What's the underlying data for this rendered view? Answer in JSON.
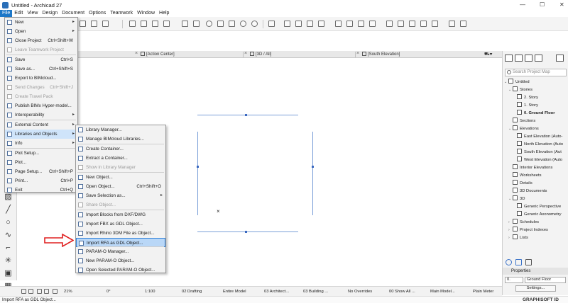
{
  "window": {
    "title": "Untitled - Archicad 27",
    "minimize": "—",
    "close": "✕"
  },
  "menubar": [
    "File",
    "Edit",
    "View",
    "Design",
    "Document",
    "Options",
    "Teamwork",
    "Window",
    "Help"
  ],
  "tabs": {
    "action_center": "[Action Center]",
    "view_3d": "[3D / All]",
    "south_elevation": "[South Elevation]"
  },
  "file_menu": [
    {
      "label": "New",
      "shortcut": "",
      "submenu": true,
      "disabled": false
    },
    {
      "label": "Open",
      "shortcut": "",
      "submenu": true,
      "disabled": false
    },
    {
      "label": "Close Project",
      "shortcut": "Ctrl+Shift+W",
      "submenu": false,
      "disabled": false
    },
    {
      "label": "Leave Teamwork Project",
      "shortcut": "",
      "submenu": false,
      "disabled": true
    },
    {
      "label": "Save",
      "shortcut": "Ctrl+S",
      "submenu": false,
      "disabled": false
    },
    {
      "label": "Save as...",
      "shortcut": "Ctrl+Shift+S",
      "submenu": false,
      "disabled": false
    },
    {
      "label": "Export to BIMcloud...",
      "shortcut": "",
      "submenu": false,
      "disabled": false
    },
    {
      "label": "Send Changes",
      "shortcut": "Ctrl+Shift+J",
      "submenu": false,
      "disabled": true
    },
    {
      "label": "Create Travel Pack",
      "shortcut": "",
      "submenu": false,
      "disabled": true
    },
    {
      "label": "Publish BIMx Hyper-model...",
      "shortcut": "",
      "submenu": false,
      "disabled": false
    },
    {
      "label": "Interoperability",
      "shortcut": "",
      "submenu": true,
      "disabled": false
    },
    {
      "label": "External Content",
      "shortcut": "",
      "submenu": true,
      "disabled": false
    },
    {
      "label": "Libraries and Objects",
      "shortcut": "",
      "submenu": true,
      "disabled": false
    },
    {
      "label": "Info",
      "shortcut": "",
      "submenu": true,
      "disabled": false
    },
    {
      "label": "Plot Setup...",
      "shortcut": "",
      "submenu": false,
      "disabled": false
    },
    {
      "label": "Plot...",
      "shortcut": "",
      "submenu": false,
      "disabled": false
    },
    {
      "label": "Page Setup...",
      "shortcut": "Ctrl+Shift+P",
      "submenu": false,
      "disabled": false
    },
    {
      "label": "Print...",
      "shortcut": "Ctrl+P",
      "submenu": false,
      "disabled": false
    },
    {
      "label": "Exit",
      "shortcut": "Ctrl+Q",
      "submenu": false,
      "disabled": false
    }
  ],
  "libraries_menu": [
    {
      "label": "Library Manager...",
      "shortcut": "",
      "submenu": false,
      "disabled": false
    },
    {
      "label": "Manage BIMcloud Libraries...",
      "shortcut": "",
      "submenu": false,
      "disabled": false
    },
    {
      "label": "Create Container...",
      "shortcut": "",
      "submenu": false,
      "disabled": false
    },
    {
      "label": "Extract a Container...",
      "shortcut": "",
      "submenu": false,
      "disabled": false
    },
    {
      "label": "Show in Library Manager",
      "shortcut": "",
      "submenu": false,
      "disabled": true
    },
    {
      "label": "New Object...",
      "shortcut": "",
      "submenu": false,
      "disabled": false
    },
    {
      "label": "Open Object...",
      "shortcut": "Ctrl+Shift+O",
      "submenu": false,
      "disabled": false
    },
    {
      "label": "Save Selection as...",
      "shortcut": "",
      "submenu": true,
      "disabled": false
    },
    {
      "label": "Share Object...",
      "shortcut": "",
      "submenu": false,
      "disabled": true
    },
    {
      "label": "Import Blocks from DXF/DWG",
      "shortcut": "",
      "submenu": false,
      "disabled": false
    },
    {
      "label": "Import FBX as GDL Object...",
      "shortcut": "",
      "submenu": false,
      "disabled": false
    },
    {
      "label": "Import Rhino 3DM File as Object...",
      "shortcut": "",
      "submenu": false,
      "disabled": false
    },
    {
      "label": "Import RFA as GDL Object...",
      "shortcut": "",
      "submenu": false,
      "disabled": false
    },
    {
      "label": "PARAM-O Manager...",
      "shortcut": "",
      "submenu": false,
      "disabled": false
    },
    {
      "label": "New PARAM-O Object...",
      "shortcut": "",
      "submenu": false,
      "disabled": false
    },
    {
      "label": "Open Selected PARAM-O Object...",
      "shortcut": "",
      "submenu": false,
      "disabled": false
    }
  ],
  "project_map": {
    "search_placeholder": "Search Project Map",
    "tree": [
      {
        "label": "Untitled",
        "level": 0,
        "bold": false
      },
      {
        "label": "Stories",
        "level": 1,
        "bold": false
      },
      {
        "label": "2. Story",
        "level": 2,
        "bold": false
      },
      {
        "label": "1. Story",
        "level": 2,
        "bold": false
      },
      {
        "label": "0. Ground Floor",
        "level": 2,
        "bold": true
      },
      {
        "label": "Sections",
        "level": 1,
        "bold": false
      },
      {
        "label": "Elevations",
        "level": 1,
        "bold": false
      },
      {
        "label": "East Elevation (Auto-",
        "level": 2,
        "bold": false
      },
      {
        "label": "North Elevation (Auto",
        "level": 2,
        "bold": false
      },
      {
        "label": "South Elevation (Aut",
        "level": 2,
        "bold": false
      },
      {
        "label": "West Elevation (Auto",
        "level": 2,
        "bold": false
      },
      {
        "label": "Interior Elevations",
        "level": 1,
        "bold": false
      },
      {
        "label": "Worksheets",
        "level": 1,
        "bold": false
      },
      {
        "label": "Details",
        "level": 1,
        "bold": false
      },
      {
        "label": "3D Documents",
        "level": 1,
        "bold": false
      },
      {
        "label": "3D",
        "level": 1,
        "bold": false
      },
      {
        "label": "Generic Perspective",
        "level": 2,
        "bold": false
      },
      {
        "label": "Generic Axonometry",
        "level": 2,
        "bold": false
      },
      {
        "label": "Schedules",
        "level": 1,
        "bold": false
      },
      {
        "label": "Project Indexes",
        "level": 1,
        "bold": false
      },
      {
        "label": "Lists",
        "level": 1,
        "bold": false
      }
    ],
    "properties_label": "Properties",
    "story_number": "0.",
    "story_name": "Ground Floor",
    "settings_label": "Settings..."
  },
  "statusbar": {
    "zoom": "21%",
    "angle": "0°",
    "scale": "1:100",
    "layer_combo": "02 Drafting",
    "model_filter": "Entire Model",
    "pen_set": "03 Architect...",
    "model_view": "03 Building ...",
    "overrides": "No Overrides",
    "renovation": "00 Show All ...",
    "structure": "Main Model...",
    "dimension": "Plain Meter"
  },
  "hint": "Import RFA as GDL Object...",
  "brand": "GRAPHISOFT ID",
  "colors": {
    "accent": "#1e78c8",
    "highlight": "#b9d7f7",
    "arrow": "#e02020"
  }
}
